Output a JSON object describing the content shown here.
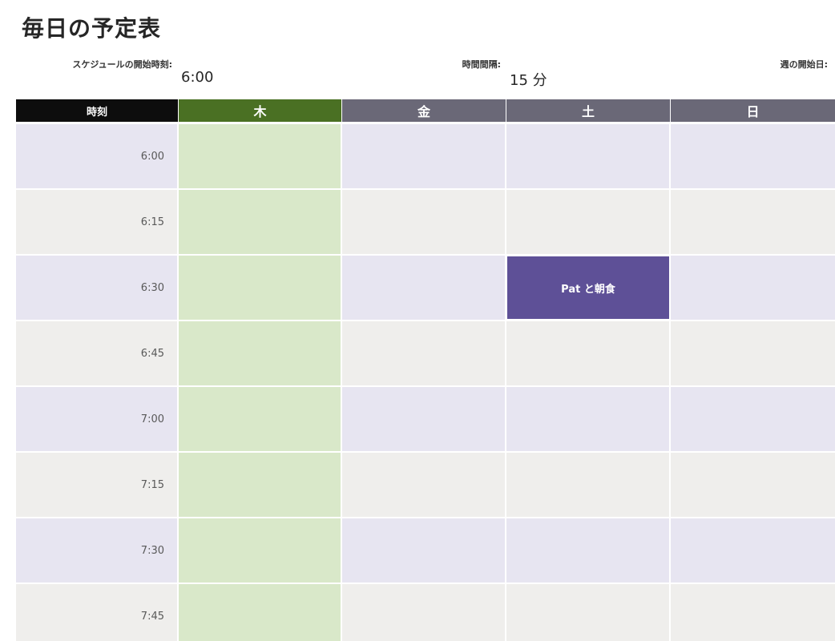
{
  "title": "毎日の予定表",
  "params": {
    "start_time_label": "スケジュールの開始時刻:",
    "start_time_value": "6:00",
    "interval_label": "時間間隔:",
    "interval_value": "15 分",
    "week_start_label": "週の開始日:"
  },
  "header": {
    "time": "時刻",
    "days": [
      "木",
      "金",
      "土",
      "日"
    ]
  },
  "times": [
    "6:00",
    "6:15",
    "6:30",
    "6:45",
    "7:00",
    "7:15",
    "7:30",
    "7:45"
  ],
  "events": [
    {
      "day": "土",
      "time": "6:30",
      "label": "Pat と朝食"
    }
  ],
  "colors": {
    "time_header": "#0d0d0d",
    "today_header": "#4a7023",
    "day_header": "#6a6877",
    "today_column": "#d9e8c9",
    "row_alt_a": "#e7e5f1",
    "row_alt_b": "#efeeec",
    "event": "#5e5097"
  }
}
